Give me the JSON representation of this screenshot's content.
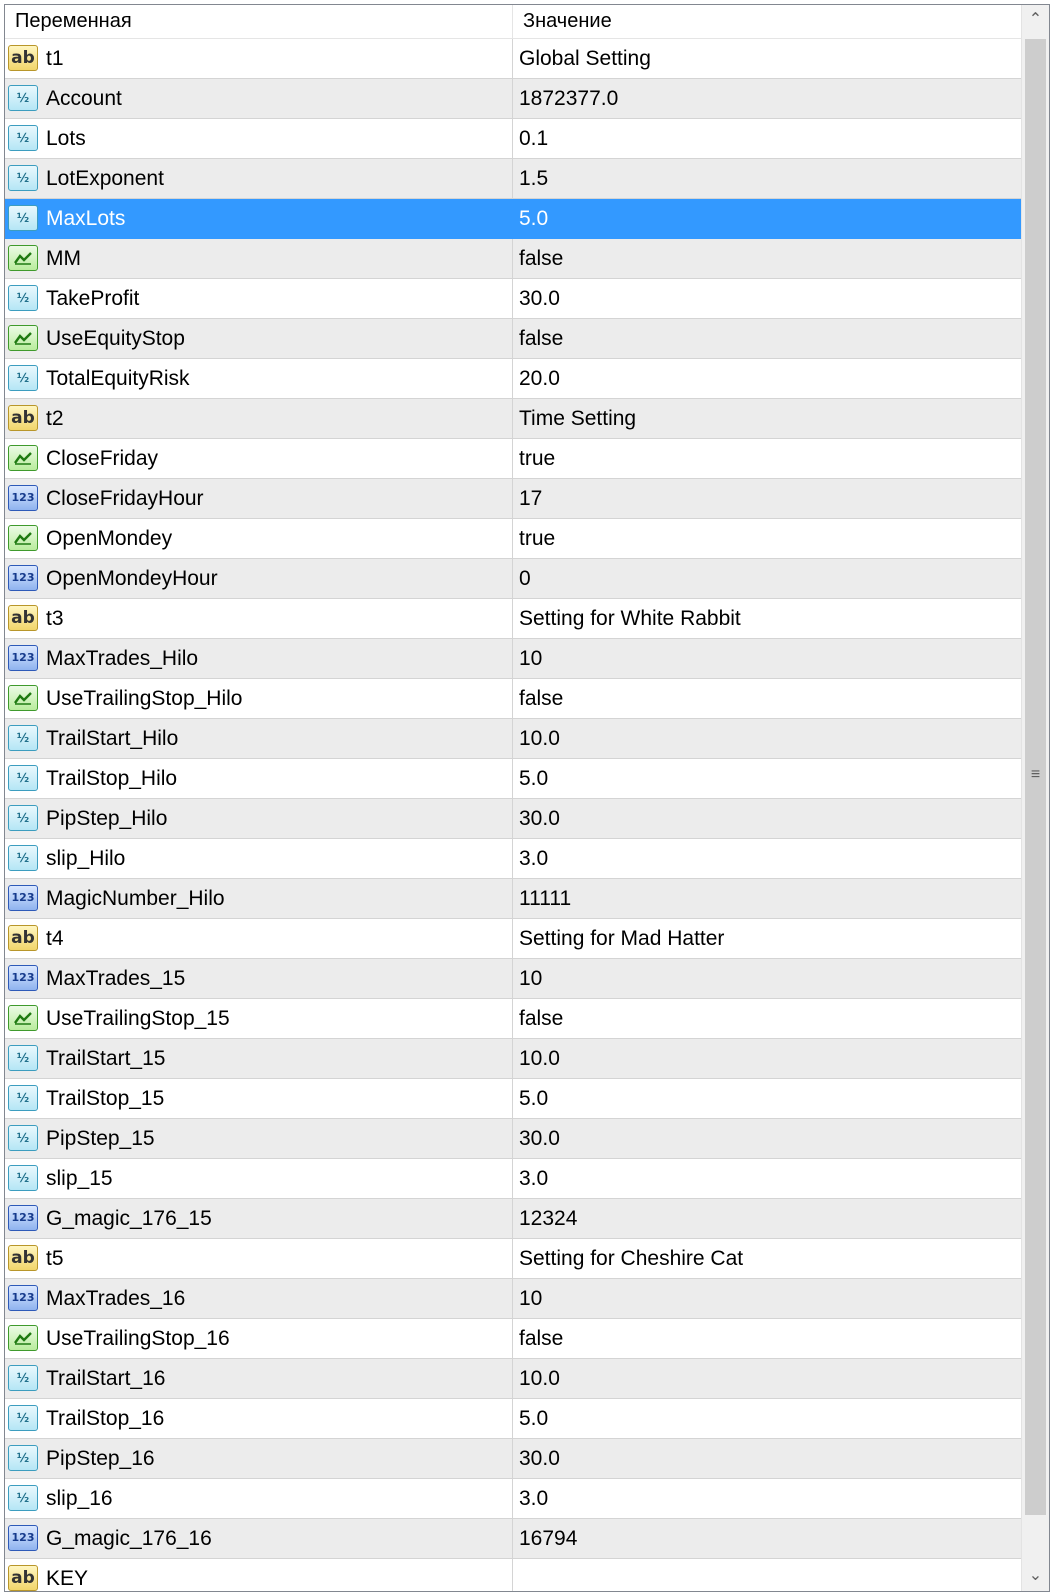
{
  "header": {
    "variable_label": "Переменная",
    "value_label": "Значение"
  },
  "selected_index": 4,
  "icon_types": {
    "string": "ab",
    "double": "½",
    "bool": "check-chart",
    "int": "123"
  },
  "rows": [
    {
      "type": "string",
      "name": "t1",
      "value": "Global Setting"
    },
    {
      "type": "double",
      "name": "Account",
      "value": "1872377.0"
    },
    {
      "type": "double",
      "name": "Lots",
      "value": "0.1"
    },
    {
      "type": "double",
      "name": "LotExponent",
      "value": "1.5"
    },
    {
      "type": "double",
      "name": "MaxLots",
      "value": "5.0"
    },
    {
      "type": "bool",
      "name": "MM",
      "value": "false"
    },
    {
      "type": "double",
      "name": "TakeProfit",
      "value": "30.0"
    },
    {
      "type": "bool",
      "name": "UseEquityStop",
      "value": "false"
    },
    {
      "type": "double",
      "name": "TotalEquityRisk",
      "value": "20.0"
    },
    {
      "type": "string",
      "name": "t2",
      "value": "Time Setting"
    },
    {
      "type": "bool",
      "name": "CloseFriday",
      "value": "true"
    },
    {
      "type": "int",
      "name": "CloseFridayHour",
      "value": "17"
    },
    {
      "type": "bool",
      "name": "OpenMondey",
      "value": "true"
    },
    {
      "type": "int",
      "name": "OpenMondeyHour",
      "value": "0"
    },
    {
      "type": "string",
      "name": "t3",
      "value": "Setting for White Rabbit"
    },
    {
      "type": "int",
      "name": "MaxTrades_Hilo",
      "value": "10"
    },
    {
      "type": "bool",
      "name": "UseTrailingStop_Hilo",
      "value": "false"
    },
    {
      "type": "double",
      "name": "TrailStart_Hilo",
      "value": "10.0"
    },
    {
      "type": "double",
      "name": "TrailStop_Hilo",
      "value": "5.0"
    },
    {
      "type": "double",
      "name": "PipStep_Hilo",
      "value": "30.0"
    },
    {
      "type": "double",
      "name": "slip_Hilo",
      "value": "3.0"
    },
    {
      "type": "int",
      "name": "MagicNumber_Hilo",
      "value": "11111"
    },
    {
      "type": "string",
      "name": "t4",
      "value": "Setting for Mad Hatter"
    },
    {
      "type": "int",
      "name": "MaxTrades_15",
      "value": "10"
    },
    {
      "type": "bool",
      "name": "UseTrailingStop_15",
      "value": "false"
    },
    {
      "type": "double",
      "name": "TrailStart_15",
      "value": "10.0"
    },
    {
      "type": "double",
      "name": "TrailStop_15",
      "value": "5.0"
    },
    {
      "type": "double",
      "name": "PipStep_15",
      "value": "30.0"
    },
    {
      "type": "double",
      "name": "slip_15",
      "value": "3.0"
    },
    {
      "type": "int",
      "name": "G_magic_176_15",
      "value": "12324"
    },
    {
      "type": "string",
      "name": "t5",
      "value": "Setting for Cheshire Cat"
    },
    {
      "type": "int",
      "name": "MaxTrades_16",
      "value": "10"
    },
    {
      "type": "bool",
      "name": "UseTrailingStop_16",
      "value": "false"
    },
    {
      "type": "double",
      "name": "TrailStart_16",
      "value": "10.0"
    },
    {
      "type": "double",
      "name": "TrailStop_16",
      "value": "5.0"
    },
    {
      "type": "double",
      "name": "PipStep_16",
      "value": "30.0"
    },
    {
      "type": "double",
      "name": "slip_16",
      "value": "3.0"
    },
    {
      "type": "int",
      "name": "G_magic_176_16",
      "value": "16794"
    },
    {
      "type": "string",
      "name": "KEY",
      "value": ""
    }
  ],
  "scrollbar": {
    "up_glyph": "⌃",
    "down_glyph": "⌄",
    "grip_glyph": "≡"
  },
  "colors": {
    "selection": "#3399ff",
    "alt_row": "#ececec"
  }
}
